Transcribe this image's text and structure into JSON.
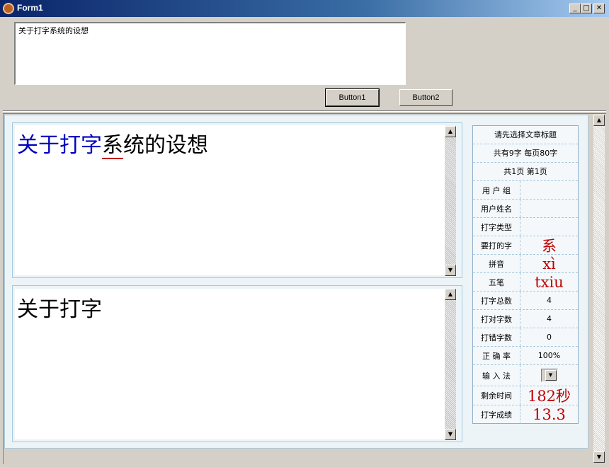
{
  "window": {
    "title": "Form1",
    "minimize": "_",
    "maximize": "□",
    "close": "✕"
  },
  "top_memo": {
    "text": "关于打字系统的设想"
  },
  "buttons": {
    "button1": "Button1",
    "button2": "Button2"
  },
  "reference_text": {
    "typed": "关于打字",
    "current": "系",
    "remaining": "统的设想"
  },
  "input_text": "关于打字",
  "stats": {
    "choose_title": "请先选择文章标题",
    "char_info": "共有9字  每页80字",
    "page_info": "共1页  第1页",
    "rows": [
      {
        "label": "用 户 组",
        "value": ""
      },
      {
        "label": "用户姓名",
        "value": ""
      },
      {
        "label": "打字类型",
        "value": ""
      },
      {
        "label": "要打的字",
        "value": "系"
      },
      {
        "label": "拼音",
        "value": "xì"
      },
      {
        "label": "五笔",
        "value": "txiu"
      },
      {
        "label": "打字总数",
        "value": "4"
      },
      {
        "label": "打对字数",
        "value": "4"
      },
      {
        "label": "打错字数",
        "value": "0"
      },
      {
        "label": "正 确 率",
        "value": "100%"
      },
      {
        "label": "输 入 法",
        "value": ""
      },
      {
        "label": "剩余时间",
        "value": "182秒"
      },
      {
        "label": "打字成绩",
        "value": "13.3"
      }
    ]
  },
  "icons": {
    "scroll_up": "▲",
    "scroll_down": "▼",
    "dropdown": "▼"
  },
  "colors": {
    "typed_text": "#0000c0",
    "highlight": "#c00000",
    "panel_bg": "#ecf4f8"
  }
}
